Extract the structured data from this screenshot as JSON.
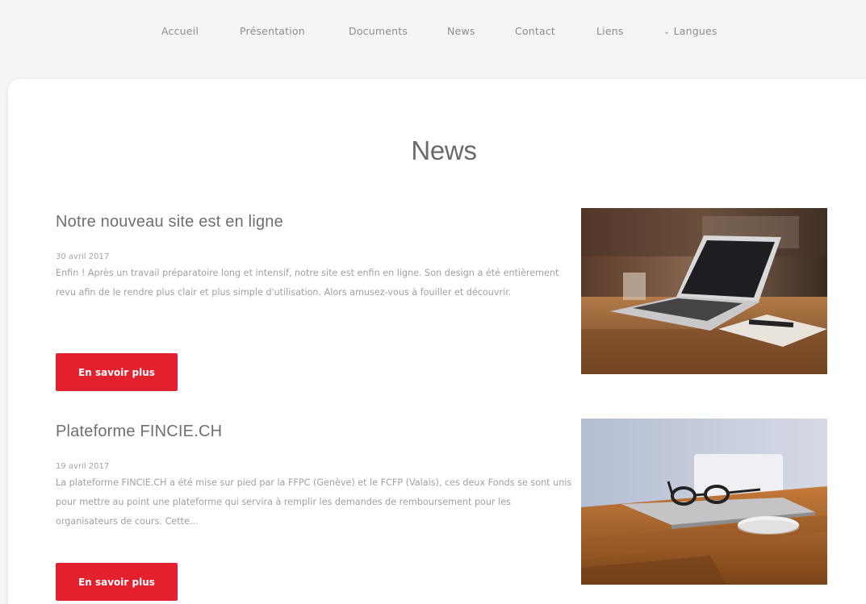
{
  "nav": {
    "items": [
      {
        "label": "Accueil"
      },
      {
        "label": "Présentation"
      },
      {
        "label": "Documents"
      },
      {
        "label": "News"
      },
      {
        "label": "Contact"
      },
      {
        "label": "Liens"
      },
      {
        "label": "Langues"
      }
    ]
  },
  "page": {
    "title": "News"
  },
  "articles": [
    {
      "title": "Notre nouveau site est en ligne",
      "date": "30 avril 2017",
      "body": "Enfin ! Après un travail préparatoire long et intensif, notre site est enfin en ligne. Son design a été entièrement revu afin de le rendre plus clair et plus simple d'utilisation. Alors amusez-vous à fouiller et découvrir.",
      "button": "En savoir plus"
    },
    {
      "title": "Plateforme FINCIE.CH",
      "date": "19 avril 2017",
      "body": "La plateforme FINCIE.CH a été mise sur pied par la FFPC (Genève) et le FCFP (Valais), ces deux Fonds se sont unis pour mettre au point une plateforme qui servira à remplir les demandes de remboursement pour les organisateurs de cours.  Cette...",
      "button": "En savoir plus"
    }
  ],
  "colors": {
    "accent": "#e3202e",
    "text_muted": "#a0a0a0"
  }
}
